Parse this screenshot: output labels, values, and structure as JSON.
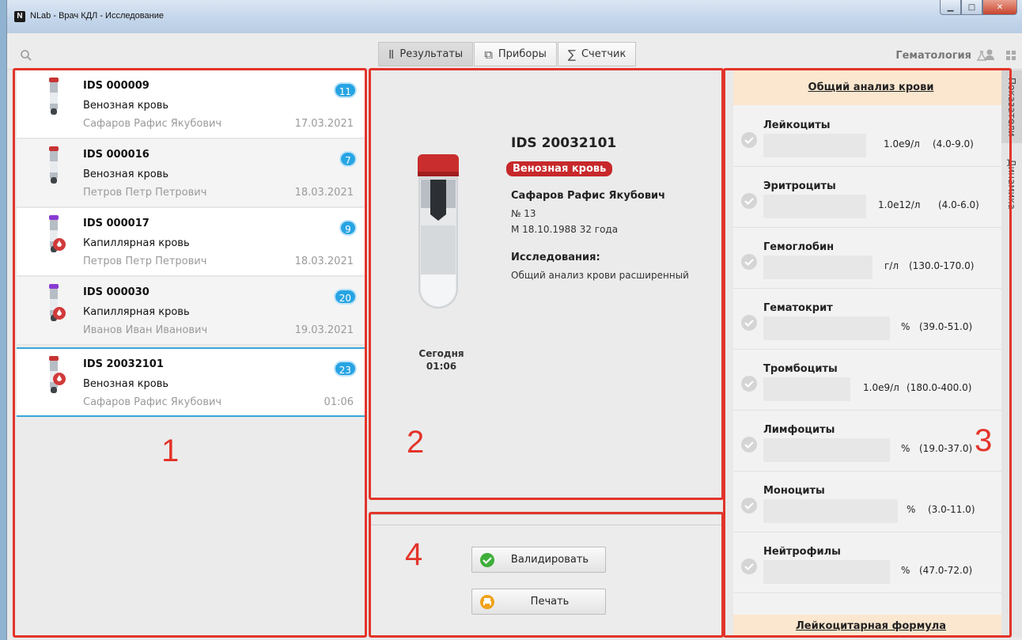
{
  "window": {
    "title": "NLab - Врач КДЛ - Исследование",
    "logo": "N",
    "controls": [
      "minimize",
      "maximize",
      "close"
    ]
  },
  "toolbar": {
    "tabs": [
      {
        "label": "Результаты",
        "icon": "test-tube-icon",
        "active": true
      },
      {
        "label": "Приборы",
        "icon": "windows-icon",
        "active": false
      },
      {
        "label": "Счетчик",
        "icon": "sigma-icon",
        "active": false
      }
    ],
    "department": "Гематология"
  },
  "samples": [
    {
      "id": "IDS 000009",
      "sample": "Венозная кровь",
      "patient": "Сафаров Рафис Якубович",
      "date": "17.03.2021",
      "count": "11",
      "cap_color": "#c73434",
      "drop": false
    },
    {
      "id": "IDS 000016",
      "sample": "Венозная кровь",
      "patient": "Петров Петр Петрович",
      "date": "18.03.2021",
      "count": "7",
      "cap_color": "#c73434",
      "drop": false
    },
    {
      "id": "IDS 000017",
      "sample": "Капиллярная кровь",
      "patient": "Петров Петр Петрович",
      "date": "18.03.2021",
      "count": "9",
      "cap_color": "#8a3bd1",
      "drop": true
    },
    {
      "id": "IDS 000030",
      "sample": "Капиллярная кровь",
      "patient": "Иванов Иван Иванович",
      "date": "19.03.2021",
      "count": "20",
      "cap_color": "#8a3bd1",
      "drop": true
    },
    {
      "id": "IDS 20032101",
      "sample": "Венозная кровь",
      "patient": "Сафаров Рафис Якубович",
      "date": "01:06",
      "count": "23",
      "cap_color": "#c73434",
      "drop": true
    }
  ],
  "detail": {
    "id": "IDS 20032101",
    "sample_badge": "Венозная кровь",
    "patient": "Сафаров Рафис Якубович",
    "number": "№ 13",
    "dob": "М 18.10.1988 32 года",
    "studies_label": "Исследования:",
    "studies": "Общий анализ крови расширенный",
    "day": "Сегодня",
    "time": "01:06"
  },
  "actions": {
    "validate": "Валидировать",
    "print": "Печать"
  },
  "results": {
    "header": "Общий анализ крови",
    "footer": "Лейкоцитарная формула",
    "params": [
      {
        "name": "Лейкоциты",
        "unit": "1.0e9/л",
        "range": "(4.0-9.0)"
      },
      {
        "name": "Эритроциты",
        "unit": "1.0e12/л",
        "range": "(4.0-6.0)"
      },
      {
        "name": "Гемоглобин",
        "unit": "г/л",
        "range": "(130.0-170.0)"
      },
      {
        "name": "Гематокрит",
        "unit": "%",
        "range": "(39.0-51.0)"
      },
      {
        "name": "Тромбоциты",
        "unit": "1.0e9/л",
        "range": "(180.0-400.0)"
      },
      {
        "name": "Лимфоциты",
        "unit": "%",
        "range": "(19.0-37.0)"
      },
      {
        "name": "Моноциты",
        "unit": "%",
        "range": "(3.0-11.0)"
      },
      {
        "name": "Нейтрофилы",
        "unit": "%",
        "range": "(47.0-72.0)"
      }
    ]
  },
  "side_tabs": [
    "Показатели",
    "Динамика"
  ],
  "annotations": [
    "1",
    "2",
    "3",
    "4"
  ],
  "colors": {
    "accent": "#27a4e3",
    "annotation": "#e3342a",
    "badge": "#c7282a",
    "header_bg": "#fbe7cf"
  }
}
